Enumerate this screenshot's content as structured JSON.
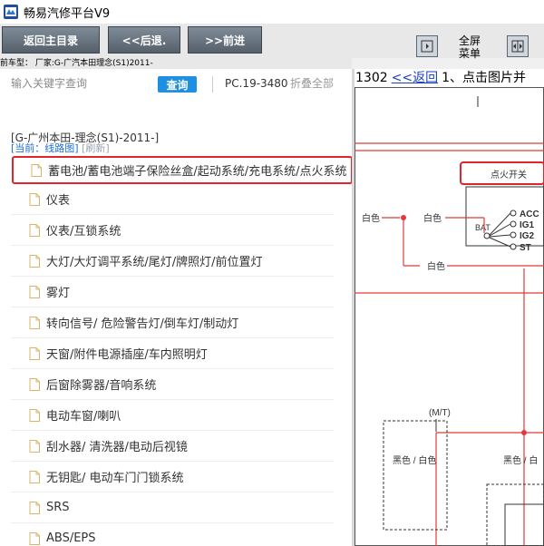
{
  "app": {
    "title": "畅易汽修平台V9"
  },
  "toolbar": {
    "home_label": "返回主目录",
    "back_label": "<<后退.",
    "forward_label": ">>前进",
    "fullscreen_label_1": "全屏",
    "fullscreen_label_2": "菜单"
  },
  "vehicle_strip": "前车型：  厂家:G-广汽本田理念(S1)2011-",
  "search": {
    "placeholder": "输入关键字查询",
    "query_label": "查询",
    "pc_code": "PC.19-3480",
    "collapse_all": "折叠全部"
  },
  "tree": {
    "vehicle": "[G-广州本田-理念(S1)-2011-]",
    "current": "[当前：线路图]",
    "refresh": "[刷新]",
    "items": [
      {
        "label": "蓄电池/蓄电池端子保险丝盒/起动系统/充电系统/点火系统",
        "selected": true
      },
      {
        "label": "仪表"
      },
      {
        "label": "仪表/互锁系统"
      },
      {
        "label": "大灯/大灯调平系统/尾灯/牌照灯/前位置灯"
      },
      {
        "label": "雾灯"
      },
      {
        "label": "转向信号/ 危险警告灯/倒车灯/制动灯"
      },
      {
        "label": "天窗/附件电源插座/车内照明灯"
      },
      {
        "label": "后窗除雾器/音响系统"
      },
      {
        "label": "电动车窗/喇叭"
      },
      {
        "label": "刮水器/ 清洗器/电动后视镜"
      },
      {
        "label": "无钥匙/ 电动车门门锁系统"
      },
      {
        "label": "SRS"
      },
      {
        "label": "ABS/EPS"
      }
    ]
  },
  "right_header": {
    "page": "1302",
    "back_link": "<<返回",
    "caption": "1、点击图片并"
  },
  "diagram": {
    "switch_label": "点火开关",
    "bat": "BAT",
    "acc": "ACC",
    "ig1": "IG1",
    "ig2": "IG2",
    "st": "ST",
    "white_1": "白色",
    "white_2": "白色",
    "white_3": "白色",
    "mt": "(M/T)",
    "black_white_1": "黑色 / 白色",
    "black_white_2": "黑色 / 白"
  },
  "colors": {
    "accent_blue": "#1e8fe1",
    "highlight_red": "#e0262c",
    "wire_red": "#e23a3a"
  }
}
